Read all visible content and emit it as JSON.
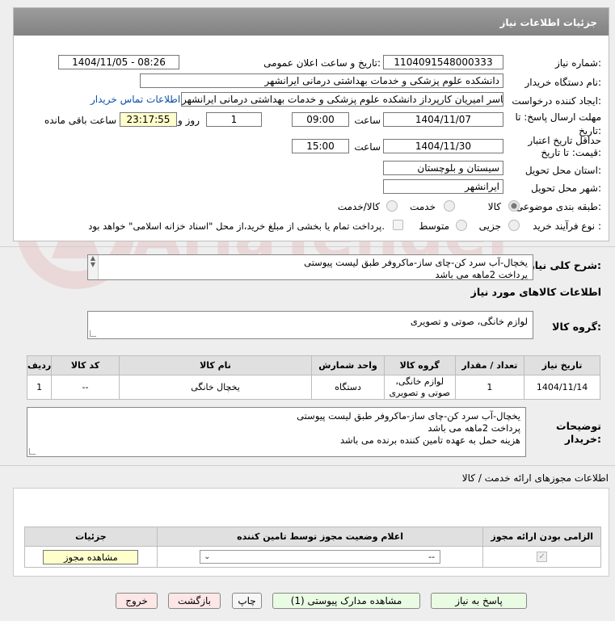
{
  "panel": {
    "title": "جزئیات اطلاعات نیاز"
  },
  "fields": {
    "need_no_label": "شماره نیاز:",
    "need_no": "1104091548000333",
    "announce_label": "تاریخ و ساعت اعلان عمومی:",
    "announce": "1404/11/05 - 08:26",
    "buyer_label": "نام دستگاه خریدار:",
    "buyer": "دانشکده علوم پزشکی و خدمات بهداشتی درمانی ایرانشهر",
    "creator_label": "ایجاد کننده درخواست:",
    "creator": "یاسر امیریان کارپرداز دانشکده علوم پزشکی و خدمات بهداشتی درمانی ایرانشهر",
    "contact_link": "اطلاعات تماس خریدار",
    "deadline_label": "مهلت ارسال پاسخ: تا تاریخ:",
    "deadline_date": "1404/11/07",
    "time_label": "ساعت",
    "deadline_time": "09:00",
    "days": "1",
    "days_label": "روز و",
    "remaining": "23:17:55",
    "remaining_label": "ساعت باقی مانده",
    "validity_label": "حداقل تاریخ اعتبار قیمت: تا تاریخ:",
    "validity_date": "1404/11/30",
    "validity_time": "15:00",
    "province_label": "استان محل تحویل:",
    "province": "سیستان و بلوچستان",
    "city_label": "شهر محل تحویل:",
    "city": "ایرانشهر",
    "category_label": "طبقه بندی موضوعی:",
    "cat_goods": "کالا",
    "cat_service": "خدمت",
    "cat_both": "کالا/خدمت",
    "process_label": "نوع فرآیند خرید :",
    "proc_partial": "جزیی",
    "proc_medium": "متوسط",
    "proc_note": "پرداخت تمام یا بخشی از مبلغ خرید،از محل \"اسناد خزانه اسلامی\" خواهد بود."
  },
  "summary": {
    "label": "شرح کلی نیاز:",
    "line1": "یخچال-آب سرد کن-چای ساز-ماکروفر طبق لیست پیوستی",
    "line2": "پرداخت 2ماهه می باشد"
  },
  "goods_info": {
    "title": "اطلاعات کالاهای مورد نیاز"
  },
  "goods_group": {
    "label": "گروه کالا:",
    "value": "لوازم خانگی، صوتی و تصویری"
  },
  "table": {
    "headers": [
      "ردیف",
      "کد کالا",
      "نام کالا",
      "واحد شمارش",
      "گروه کالا",
      "تعداد / مقدار",
      "تاریخ نیاز"
    ],
    "row": {
      "idx": "1",
      "code": "--",
      "name": "یخچال خانگی",
      "unit": "دستگاه",
      "group": "لوازم خانگی، صوتی و تصویری",
      "qty": "1",
      "date": "1404/11/14"
    }
  },
  "buyer_notes": {
    "label": "توضیحات خریدار:",
    "line1": "یخچال-آب سرد کن-چای ساز-ماکروفر طبق لیست پیوستی",
    "line2": "پرداخت 2ماهه می باشد",
    "line3": "هزینه حمل به عهده تامین کننده برنده می باشد"
  },
  "permits": {
    "title": "اطلاعات مجوزهای ارائه خدمت / کالا",
    "col_required": "الزامی بودن ارائه مجوز",
    "col_status": "اعلام وضعیت مجوز توسط تامین کننده",
    "col_details": "جزئیات",
    "select_value": "--",
    "view_button": "مشاهده مجوز"
  },
  "buttons": {
    "reply": "پاسخ به نیاز",
    "attachments": "مشاهده مدارک پیوستی (1)",
    "print": "چاپ",
    "back": "بازگشت",
    "exit": "خروج"
  },
  "watermark": {
    "text": "AriaTender.neT"
  },
  "colors": {
    "header": "#8f8f8f",
    "highlight": "#ffffcc",
    "link": "#0a4fa8"
  }
}
